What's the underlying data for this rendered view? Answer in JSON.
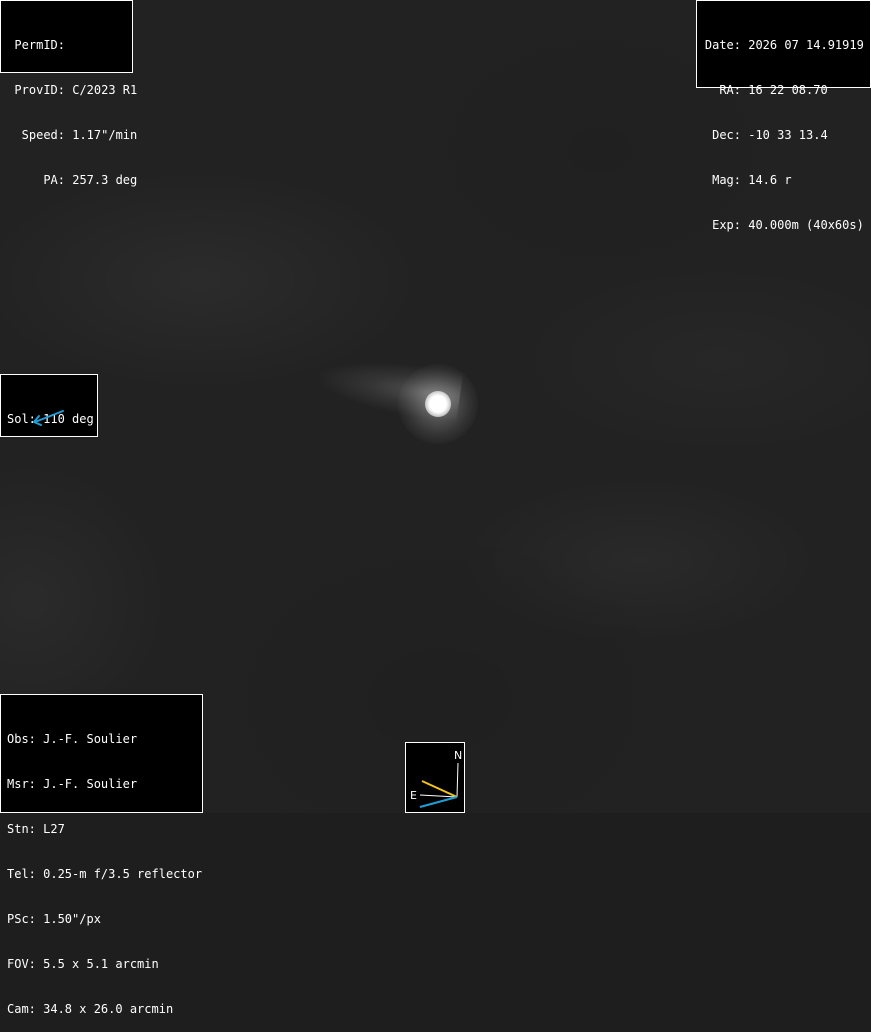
{
  "object_info": {
    "rows": [
      {
        "label": "PermID:",
        "value": ""
      },
      {
        "label": "ProvID:",
        "value": "C/2023 R1"
      },
      {
        "label": "Speed:",
        "value": "1.17\"/min"
      },
      {
        "label": "PA:",
        "value": "257.3 deg"
      }
    ]
  },
  "observation_info": {
    "rows": [
      {
        "label": "Date:",
        "value": "2026 07 14.91919"
      },
      {
        "label": "RA:",
        "value": "16 22 08.70"
      },
      {
        "label": "Dec:",
        "value": "-10 33 13.4"
      },
      {
        "label": "Mag:",
        "value": "14.6 r"
      },
      {
        "label": "Exp:",
        "value": "40.000m (40x60s)"
      }
    ]
  },
  "solar_elongation": {
    "text": "Sol: 110 deg",
    "arrow_color": "#1e9fd8",
    "arrow_icon": "arrow-down-left-icon"
  },
  "station_info": {
    "rows": [
      "Obs: J.-F. Soulier",
      "Msr: J.-F. Soulier",
      "Stn: L27",
      "Tel: 0.25-m f/3.5 reflector",
      "PSc: 1.50\"/px",
      "FOV: 5.5 x 5.1 arcmin",
      "Cam: 34.8 x 26.0 arcmin"
    ]
  },
  "compass": {
    "north_label": "N",
    "east_label": "E",
    "motion_vector_color": "#f0c419",
    "sun_vector_color": "#1e9fd8",
    "axis_color": "#ffffff"
  }
}
